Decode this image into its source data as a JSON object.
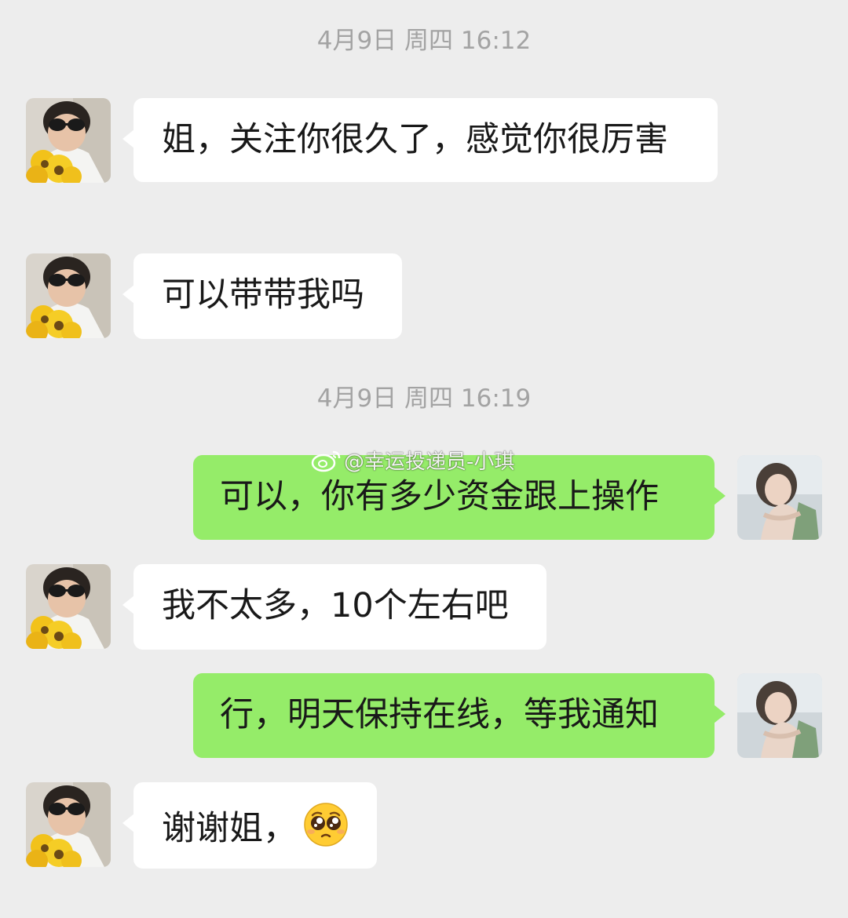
{
  "chat": {
    "timestamps": [
      "4月9日 周四 16:12",
      "4月9日 周四 16:19"
    ],
    "messages": [
      {
        "from": "contact",
        "text": "姐，关注你很久了，感觉你很厉害"
      },
      {
        "from": "contact",
        "text": "可以带带我吗"
      },
      {
        "from": "me",
        "text": "可以，你有多少资金跟上操作"
      },
      {
        "from": "contact",
        "text": "我不太多，10个左右吧"
      },
      {
        "from": "me",
        "text": "行，明天保持在线，等我通知"
      },
      {
        "from": "contact",
        "text": "谢谢姐，",
        "emoji": "pleading-face-emoji"
      }
    ]
  },
  "watermark": {
    "text": "@幸运投递员-小琪",
    "icon": "weibo-logo-icon"
  },
  "colors": {
    "background": "#ededed",
    "incoming_bubble": "#ffffff",
    "outgoing_bubble": "#95ec69",
    "timestamp_text": "#a3a3a3",
    "message_text": "#191919"
  }
}
